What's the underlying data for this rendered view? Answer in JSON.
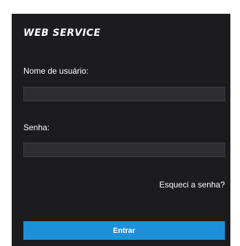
{
  "login": {
    "brand": "WEB SERVICE",
    "username_label": "Nome de usuário:",
    "username_value": "",
    "password_label": "Senha:",
    "password_value": "",
    "forgot_link": "Esqueci a senha?",
    "submit_label": "Entrar"
  },
  "colors": {
    "panel_background": "#1c1c1e",
    "input_background": "#2e2e32",
    "accent": "#1e90d9",
    "text": "#ffffff"
  }
}
